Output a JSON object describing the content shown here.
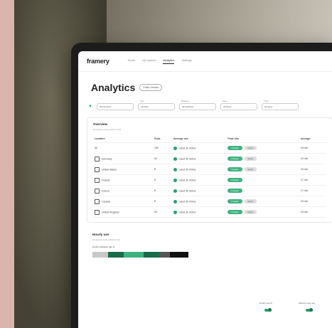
{
  "app": {
    "logo": "framery",
    "nav": [
      "Home",
      "My spaces",
      "Analytics",
      "Settings"
    ]
  },
  "page": {
    "title": "Analytics",
    "badge": "Public Version"
  },
  "filters": [
    {
      "label": "",
      "value": "All countries"
    },
    {
      "label": "City",
      "value": "All cities"
    },
    {
      "label": "Building",
      "value": "All buildings"
    },
    {
      "label": "Floor",
      "value": "All floors"
    },
    {
      "label": "Type",
      "value": "All types"
    }
  ],
  "overview": {
    "title": "Overview",
    "subtitle": "All spaces during 2021-04-01",
    "columns": [
      "Location",
      "Pods",
      "Average use",
      "Pods hits",
      "Average"
    ],
    "rows": [
      {
        "location": "All",
        "pods": "159",
        "use": "Used 3h 4mins",
        "tags": [
          "Popular",
          "Quiet"
        ],
        "avg": "29 min"
      },
      {
        "location": "Germany",
        "pods": "54",
        "use": "Used 3h 4mins",
        "tags": [
          "Popular",
          "Quiet"
        ],
        "avg": "29 min"
      },
      {
        "location": "United States",
        "pods": "8",
        "use": "Used 3h 4mins",
        "tags": [
          "Popular",
          "Quiet"
        ],
        "avg": "24 min"
      },
      {
        "location": "Finland",
        "pods": "8",
        "use": "Used 3h 4mins",
        "tags": [
          "Popular"
        ],
        "avg": "17 min"
      },
      {
        "location": "France",
        "pods": "8",
        "use": "Used 3h 4mins",
        "tags": [
          "Popular"
        ],
        "avg": "17 min"
      },
      {
        "location": "Canada",
        "pods": "8",
        "use": "Used 3h 4mins",
        "tags": [
          "Popular",
          "Quiet"
        ],
        "avg": "29 min"
      },
      {
        "location": "United Kingdom",
        "pods": "54",
        "use": "Used 3h 4mins",
        "tags": [
          "Popular",
          "Quiet"
        ],
        "avg": "29 min"
      }
    ]
  },
  "hourly": {
    "title": "Hourly use",
    "subtitle": "All spaces during 2021-04-01",
    "label": "Hourly utilization rate %",
    "toggle1": "Hourly use %",
    "toggle2": "Show by avg use",
    "bar_segments": [
      {
        "color": "#c8c8c8",
        "weight": 1
      },
      {
        "color": "#1a6b47",
        "weight": 1
      },
      {
        "color": "#3fb27f",
        "weight": 1.3
      },
      {
        "color": "#1a6b47",
        "weight": 1
      },
      {
        "color": "#555",
        "weight": 0.7
      },
      {
        "color": "#111",
        "weight": 1.2
      }
    ]
  },
  "colors": {
    "accent": "#2e9e6b"
  }
}
